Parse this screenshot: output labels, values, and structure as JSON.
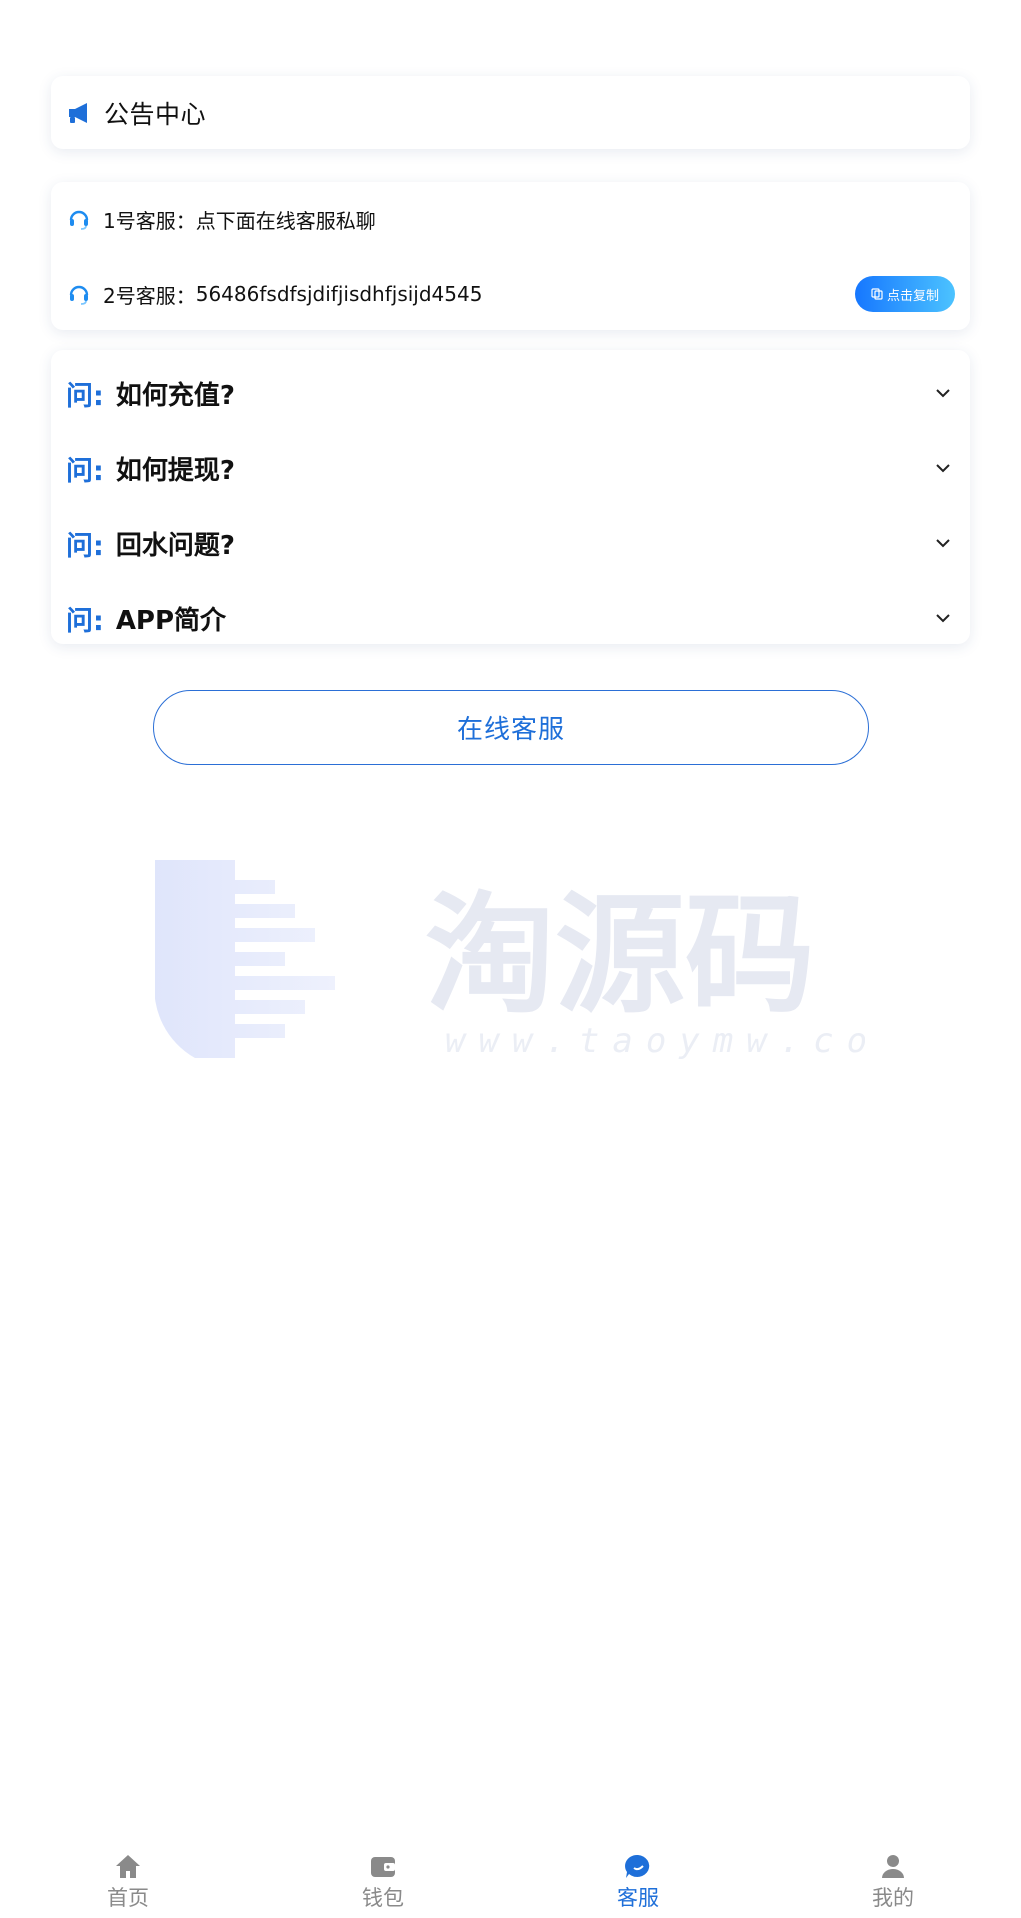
{
  "notice": {
    "icon": "megaphone-icon",
    "title": "公告中心"
  },
  "service": {
    "rows": [
      {
        "icon": "headset-icon",
        "label": "1号客服：",
        "value": "点下面在线客服私聊"
      },
      {
        "icon": "headset-icon",
        "label": "2号客服：",
        "value": "56486fsdfsjdifjisdhfjsijd4545",
        "copy_label": "点击复制"
      }
    ]
  },
  "faq": {
    "prefix": "问:",
    "items": [
      {
        "question": "如何充值?"
      },
      {
        "question": "如何提现?"
      },
      {
        "question": "回水问题?"
      },
      {
        "question": "APP简介"
      }
    ]
  },
  "online_button": {
    "label": "在线客服"
  },
  "watermark": {
    "main_text": "淘源码",
    "url_text": "www.taoymw.com"
  },
  "tabbar": {
    "items": [
      {
        "label": "首页",
        "icon": "home-icon",
        "active": false
      },
      {
        "label": "钱包",
        "icon": "wallet-icon",
        "active": false
      },
      {
        "label": "客服",
        "icon": "chat-icon",
        "active": true
      },
      {
        "label": "我的",
        "icon": "user-icon",
        "active": false
      }
    ]
  },
  "colors": {
    "accent": "#1e6fd9",
    "inactive_tab": "#8a8a8a",
    "copy_gradient_start": "#1677ff",
    "copy_gradient_end": "#4cc3ff"
  }
}
